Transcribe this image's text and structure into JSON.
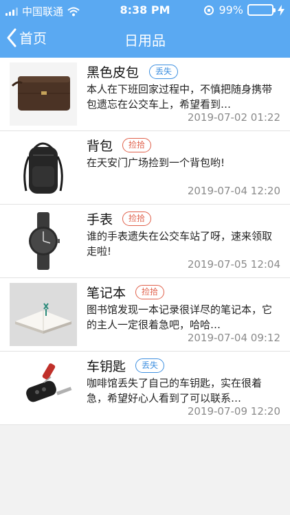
{
  "status_bar": {
    "carrier": "中国联通",
    "time": "8:38 PM",
    "battery": "99%",
    "battery_level": 0.99
  },
  "nav": {
    "back_label": "首页",
    "title": "日用品"
  },
  "items": [
    {
      "title": "黑色皮包",
      "tag": "丢失",
      "desc": "本人在下班回家过程中，不慎把随身携带包遗忘在公交车上，希望看到…",
      "time": "2019-07-02 01:22"
    },
    {
      "title": "背包",
      "tag": "捡拾",
      "desc": "在天安门广场捡到一个背包哟!",
      "time": "2019-07-04 12:20"
    },
    {
      "title": "手表",
      "tag": "捡拾",
      "desc": "谁的手表遗失在公交车站了呀，速来领取走啦!",
      "time": "2019-07-05 12:04"
    },
    {
      "title": "笔记本",
      "tag": "捡拾",
      "desc": "图书馆发现一本记录很详尽的笔记本，它的主人一定很着急吧，哈哈…",
      "time": "2019-07-04 09:12"
    },
    {
      "title": "车钥匙",
      "tag": "丢失",
      "desc": "咖啡馆丢失了自己的车钥匙，实在很着急，希望好心人看到了可以联系…",
      "time": "2019-07-09 12:20"
    }
  ],
  "colors": {
    "bar_bg": "#5aa9f2",
    "tag_lost": "#3d8fe0",
    "tag_found": "#e0604a",
    "battery": "#4cd964"
  }
}
